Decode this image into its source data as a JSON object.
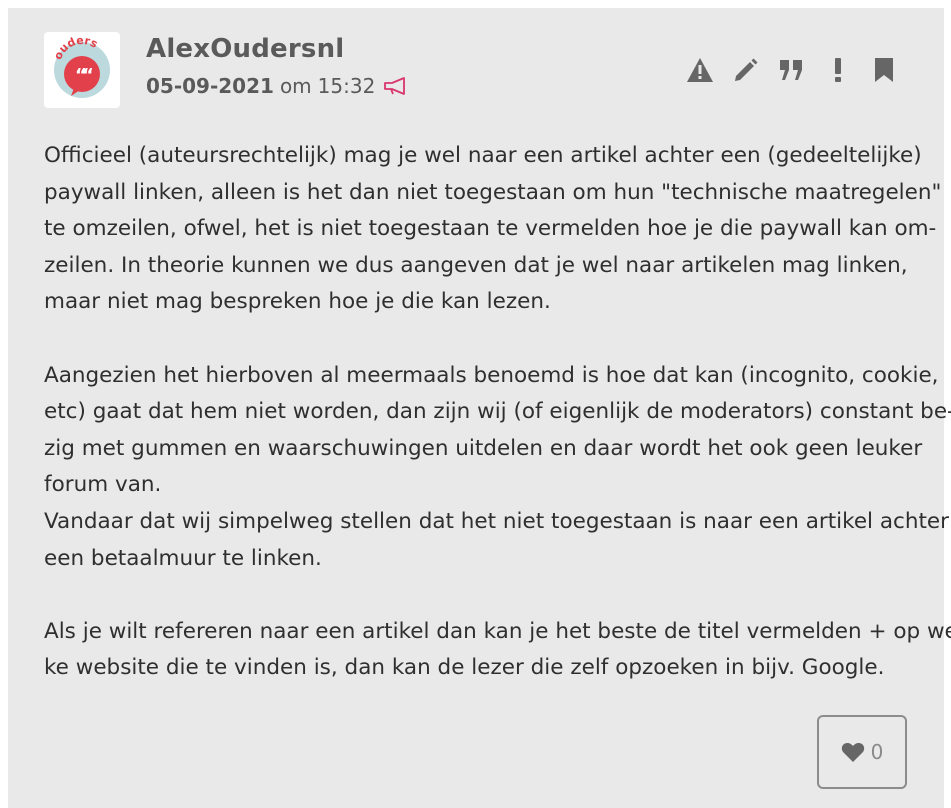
{
  "post": {
    "author": "AlexOudersnl",
    "date": "05-09-2021",
    "time_prefix": "om",
    "time": "15:32",
    "avatar_text": "ouders",
    "colors": {
      "background": "#e9e9e9",
      "avatar_red": "#e2404a",
      "megaphone": "#d9366f",
      "icon_gray": "#666666"
    },
    "icons": {
      "announce": "megaphone-icon",
      "report": "warning-icon",
      "edit": "pencil-icon",
      "quote": "quote-icon",
      "alert": "exclamation-icon",
      "bookmark": "bookmark-icon",
      "like": "heart-icon"
    },
    "paragraphs": [
      [
        "Officieel (auteursrechtelijk) mag je wel naar een artikel achter een (gedeeltelijke)",
        "paywall linken, alleen is het dan niet toegestaan om hun \"technische maatregelen\"",
        "te omzeilen, ofwel, het is niet toegestaan te vermelden hoe je die paywall kan om-",
        "zeilen. In theorie kunnen we dus aangeven dat je wel naar artikelen mag linken,",
        "maar niet mag bespreken hoe je die kan lezen."
      ],
      [
        "Aangezien het hierboven al meermaals benoemd is hoe dat kan (incognito, cookie,",
        "etc) gaat dat hem niet worden, dan zijn wij (of eigenlijk de moderators) constant be-",
        "zig met gummen en waarschuwingen uitdelen en daar wordt het ook geen leuker",
        "forum van.",
        "Vandaar dat wij simpelweg stellen dat het niet toegestaan is naar een artikel achter",
        "een betaalmuur te linken."
      ],
      [
        "Als je wilt refereren naar een artikel dan kan je het beste de titel vermelden + op wel-",
        "ke website die te vinden is, dan kan de lezer die zelf opzoeken in bijv. Google."
      ]
    ],
    "likes": "0"
  }
}
